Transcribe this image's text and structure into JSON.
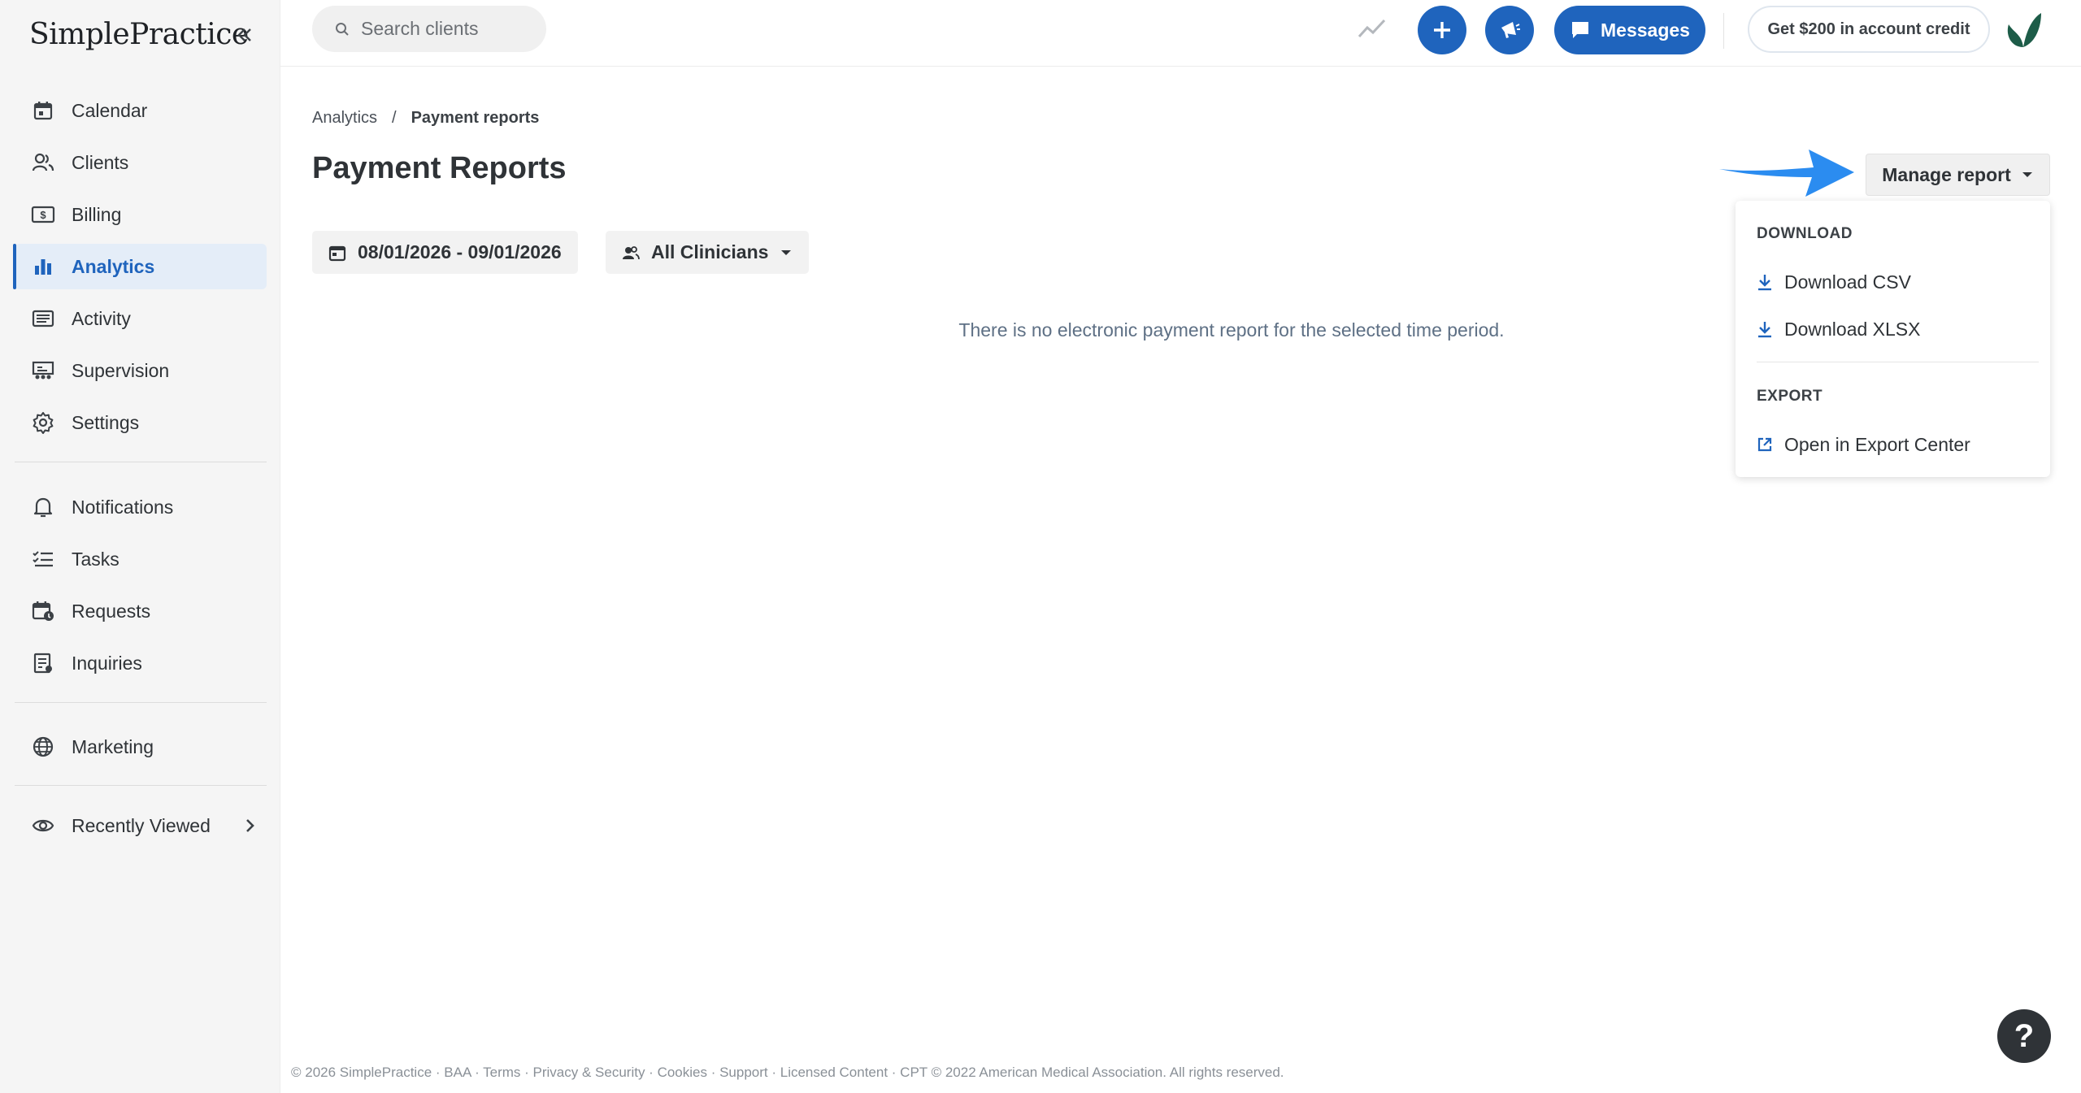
{
  "app": {
    "logo_text": "SimplePractice"
  },
  "sidebar": {
    "items": [
      {
        "label": "Calendar",
        "icon": "calendar-icon"
      },
      {
        "label": "Clients",
        "icon": "clients-icon"
      },
      {
        "label": "Billing",
        "icon": "billing-icon"
      },
      {
        "label": "Analytics",
        "icon": "analytics-icon",
        "active": true
      },
      {
        "label": "Activity",
        "icon": "activity-icon"
      },
      {
        "label": "Supervision",
        "icon": "supervision-icon"
      },
      {
        "label": "Settings",
        "icon": "gear-icon"
      }
    ],
    "secondary": [
      {
        "label": "Notifications",
        "icon": "bell-icon"
      },
      {
        "label": "Tasks",
        "icon": "tasks-icon"
      },
      {
        "label": "Requests",
        "icon": "requests-icon"
      },
      {
        "label": "Inquiries",
        "icon": "inquiries-icon"
      }
    ],
    "marketing": {
      "label": "Marketing",
      "icon": "globe-icon"
    },
    "recently_viewed": {
      "label": "Recently Viewed",
      "icon": "eye-icon"
    }
  },
  "topbar": {
    "search_placeholder": "Search clients",
    "messages_label": "Messages",
    "credit_label": "Get $200 in account credit"
  },
  "breadcrumb": {
    "parent": "Analytics",
    "separator": "/",
    "current": "Payment reports"
  },
  "page": {
    "title": "Payment Reports",
    "date_range": "08/01/2026 - 09/01/2026",
    "clinicians": "All Clinicians",
    "empty_message": "There is no electronic payment report for the selected time period."
  },
  "manage": {
    "label": "Manage report",
    "download_header": "DOWNLOAD",
    "download_csv": "Download CSV",
    "download_xlsx": "Download XLSX",
    "export_header": "EXPORT",
    "export_center": "Open in Export Center"
  },
  "footer": {
    "text": "© 2026 SimplePractice · BAA · Terms · Privacy & Security · Cookies · Support · Licensed Content · CPT © 2022 American Medical Association. All rights reserved."
  },
  "help": {
    "label": "?"
  },
  "colors": {
    "accent": "#1f64bd",
    "arrow": "#2b8cf0"
  }
}
